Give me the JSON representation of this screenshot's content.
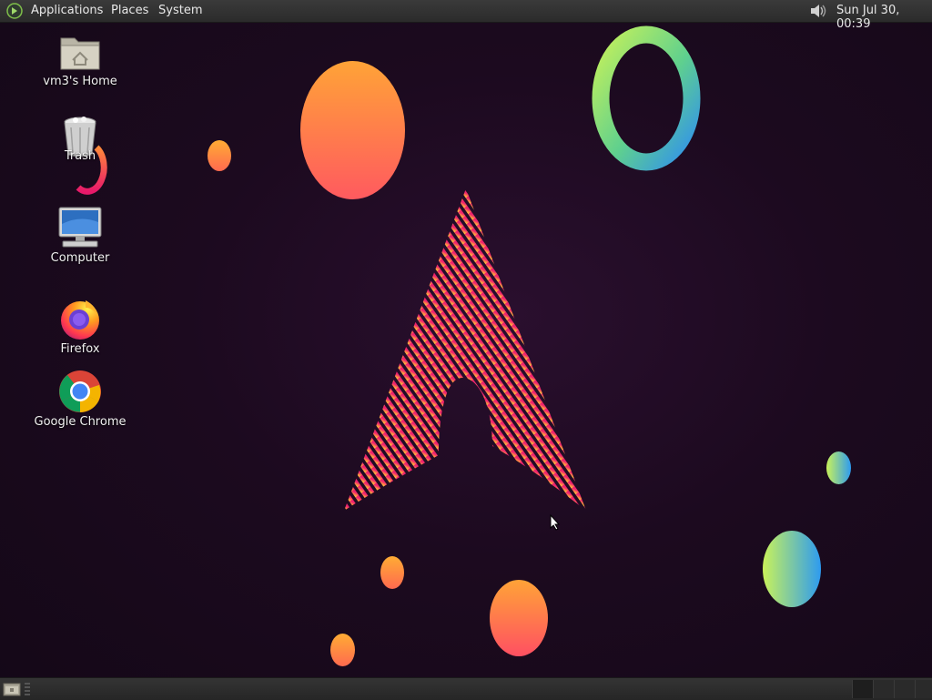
{
  "top_panel": {
    "menus": [
      "Applications",
      "Places",
      "System"
    ],
    "clock": "Sun Jul 30, 00:39",
    "tray_icons": [
      "volume-icon"
    ]
  },
  "desktop": {
    "icons": [
      {
        "label": "vm3's Home",
        "icon": "home-folder-icon"
      },
      {
        "label": "Trash",
        "icon": "trash-icon"
      },
      {
        "label": "Computer",
        "icon": "computer-icon"
      },
      {
        "label": "Firefox",
        "icon": "firefox-icon"
      },
      {
        "label": "Google Chrome",
        "icon": "chrome-icon"
      }
    ]
  },
  "bottom_panel": {
    "items": [
      "show-desktop-icon",
      "workspace-switcher"
    ]
  },
  "colors": {
    "background": "#1c0a1f",
    "accent_pink": "#e8196a",
    "accent_orange": "#ff9f3a",
    "accent_yellow": "#f5e43a",
    "accent_green": "#b8f05a",
    "accent_blue": "#2f8ff0"
  }
}
